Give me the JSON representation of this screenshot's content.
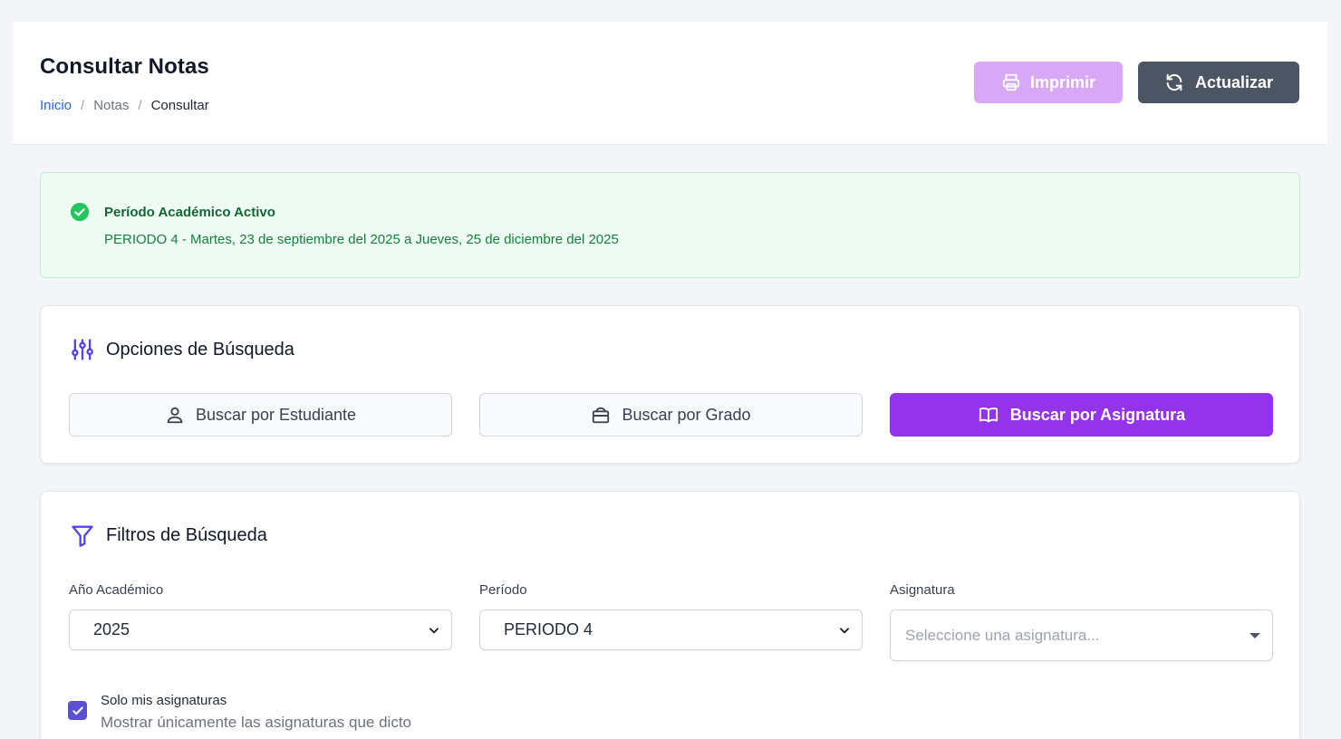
{
  "header": {
    "title": "Consultar Notas",
    "breadcrumb": [
      "Inicio",
      "Notas",
      "Consultar"
    ],
    "breadcrumb_sep": "/",
    "print_label": "Imprimir",
    "refresh_label": "Actualizar"
  },
  "alert": {
    "title": "Período Académico Activo",
    "text": "PERIODO 4 - Martes, 23 de septiembre del 2025 a Jueves, 25 de diciembre del 2025",
    "icon": "check-circle-icon"
  },
  "search_options": {
    "title": "Opciones de Búsqueda",
    "icon": "sliders-icon",
    "buttons": [
      {
        "label": "Buscar por Estudiante",
        "icon": "user-icon",
        "active": false
      },
      {
        "label": "Buscar por Grado",
        "icon": "layers-icon",
        "active": false
      },
      {
        "label": "Buscar por Asignatura",
        "icon": "book-icon",
        "active": true
      }
    ]
  },
  "filters": {
    "title": "Filtros de Búsqueda",
    "icon": "filter-icon",
    "year": {
      "label": "Año Académico",
      "value": "2025"
    },
    "period": {
      "label": "Período",
      "value": "PERIODO 4"
    },
    "subject": {
      "label": "Asignatura",
      "placeholder": "Seleccione una asignatura..."
    },
    "only_mine": {
      "label": "Solo mis asignaturas",
      "help": "Mostrar únicamente las asignaturas que dicto",
      "checked": true
    }
  },
  "colors": {
    "accent": "#9333ea",
    "accent_light": "#d8a8f6",
    "dark_button": "#4b5563",
    "success_bg": "#eefcf3",
    "success_text": "#15803d",
    "icon_indigo": "#4f46e5"
  }
}
